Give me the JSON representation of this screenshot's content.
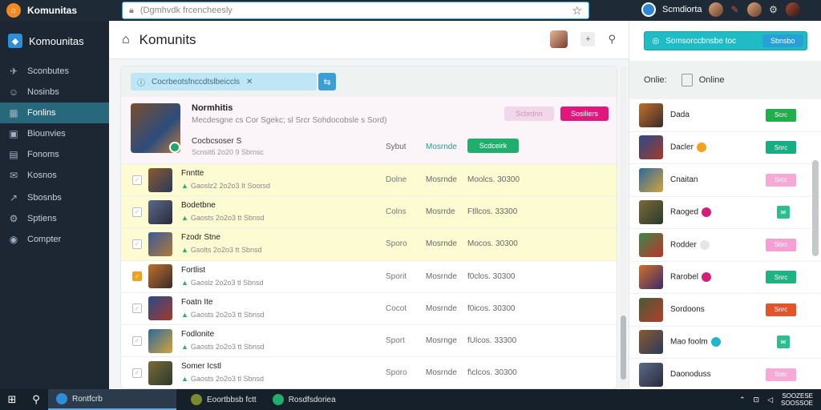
{
  "browser": {
    "app_name": "Komunitas",
    "url": "(Dgmhvdk frcencheesly",
    "profile_name": "Scmdiorta"
  },
  "sidebar": {
    "brand": "Komounitas",
    "items": [
      {
        "label": "Sconbutes",
        "icon": "rocket-icon"
      },
      {
        "label": "Nosinbs",
        "icon": "users-icon"
      },
      {
        "label": "Fonlins",
        "icon": "grid-icon"
      },
      {
        "label": "Biounvies",
        "icon": "image-icon"
      },
      {
        "label": "Fonoms",
        "icon": "inbox-icon"
      },
      {
        "label": "Kosnos",
        "icon": "mail-icon"
      },
      {
        "label": "Sbosnbs",
        "icon": "chart-icon"
      },
      {
        "label": "Sptiens",
        "icon": "gear-icon"
      },
      {
        "label": "Compter",
        "icon": "globe-icon"
      }
    ],
    "active_index": 2
  },
  "header": {
    "title": "Komunits"
  },
  "search": {
    "text": "Cocrbeotsfnccdtslbeiccls"
  },
  "hero": {
    "title": "Normhitis",
    "description": "Mecdesgne cs Cor Sgekc; sl Srcr Sohdocobsle s Sord)",
    "subtitle": "Cocbcsoser S",
    "meta": "Scnsit6 2o20 9 Sbrnsc",
    "status": "Sybut",
    "mode": "Mosrnde",
    "btn_light": "Scbrdnn",
    "btn_pink": "Sosiliers",
    "btn_green": "Scdceirk"
  },
  "rows": [
    {
      "name": "Fnntte",
      "meta": "Gaoslz2 2o2o3 It Soorsd",
      "status": "Dolne",
      "mode": "Mosrnde",
      "count": "Moolcs. 30300",
      "highlight": true,
      "checked": false
    },
    {
      "name": "Bodetbne",
      "meta": "Gaosts 2o2o3 tt Sbnsd",
      "status": "Colns",
      "mode": "Mosrrde",
      "count": "Ftllcos. 33300",
      "highlight": true,
      "checked": false
    },
    {
      "name": "Fzodr Stne",
      "meta": "Gsolts 2o2o3 tt Sbnsd",
      "status": "Sporo",
      "mode": "Mosrnde",
      "count": "Mocos. 30300",
      "highlight": true,
      "checked": false
    },
    {
      "name": "Fortlist",
      "meta": "Gaoslz 2o2o3 tl Sbnsd",
      "status": "Sporit",
      "mode": "Mosrnde",
      "count": "f0clos. 30300",
      "highlight": false,
      "checked": true
    },
    {
      "name": "Foatn Ite",
      "meta": "Gaosts 2o2o3 tt Sbnsd",
      "status": "Cocot",
      "mode": "Mosrnde",
      "count": "f0icos. 30300",
      "highlight": false,
      "checked": false
    },
    {
      "name": "Fodlonite",
      "meta": "Gaosts 2o2o3 tt Sbnsd",
      "status": "Sport",
      "mode": "Mosrnge",
      "count": "fUlcos. 33300",
      "highlight": false,
      "checked": false
    },
    {
      "name": "Somer Icstl",
      "meta": "Gaosts 2o2o3 tl Sbnsd",
      "status": "Sporo",
      "mode": "Mosrnde",
      "count": "f\\clcos. 30300",
      "highlight": false,
      "checked": false
    }
  ],
  "right_panel": {
    "top_btn": "Somsorccbnsbe toc",
    "top_pill": "Sbnsbo",
    "online_label": "Onlie:",
    "online_label2": "Online",
    "friends": [
      {
        "name": "Dada",
        "btn": "Scrc",
        "btn_color": "#1fae4a",
        "badge": ""
      },
      {
        "name": "Dacler",
        "btn": "Snrc",
        "btn_color": "#17ae83",
        "badge": "#f0a21d"
      },
      {
        "name": "Cnaitan",
        "btn": "Srcc",
        "btn_color": "#f6a9d4",
        "badge": ""
      },
      {
        "name": "Raoged",
        "btn": "",
        "btn_color": "#2bbf8e",
        "badge": "#d1207a",
        "small": true
      },
      {
        "name": "Rodder",
        "btn": "Snrc",
        "btn_color": "#f4a0d2",
        "badge": "#e6e6e6"
      },
      {
        "name": "Rarobel",
        "btn": "Snrc",
        "btn_color": "#1fb384",
        "badge": "#d1207a"
      },
      {
        "name": "Sordoons",
        "btn": "Snrc",
        "btn_color": "#e3542b",
        "badge": ""
      },
      {
        "name": "Mao foolm",
        "btn": "",
        "btn_color": "#2bbf8e",
        "badge": "#1fb6c9",
        "small": true
      },
      {
        "name": "Daonoduss",
        "btn": "Sntc",
        "btn_color": "#f6a9d4",
        "badge": ""
      }
    ]
  },
  "taskbar": {
    "apps": [
      {
        "label": "Rontfcrb",
        "color": "#2d8fd8",
        "active": true
      },
      {
        "label": "Eoortbbsb fctt",
        "color": "#7a8a2c",
        "active": false
      },
      {
        "label": "Rosdfsdoriea",
        "color": "#1fae6c",
        "active": false
      }
    ],
    "clock_line1": "SOOZESE",
    "clock_line2": "SOOSSOE"
  }
}
